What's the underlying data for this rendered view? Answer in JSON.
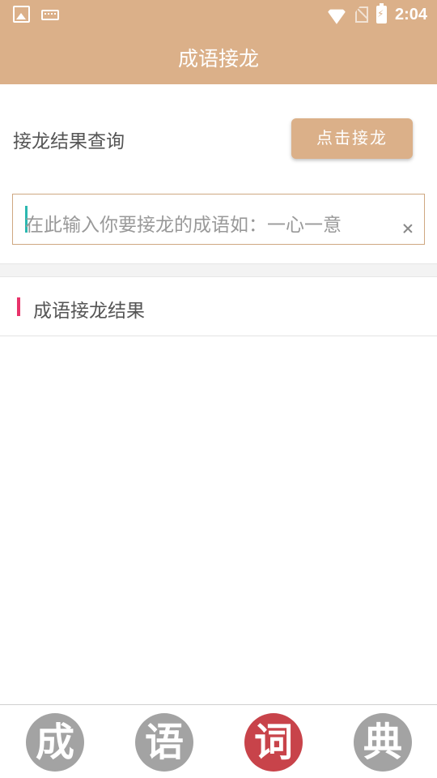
{
  "status_bar": {
    "time": "2:04",
    "left_icons": [
      "image-icon",
      "keyboard-icon"
    ],
    "right_icons": [
      "wifi-icon",
      "no-sim-icon",
      "battery-charging-icon"
    ]
  },
  "header": {
    "title": "成语接龙"
  },
  "query": {
    "label": "接龙结果查询",
    "button_label": "点击接龙"
  },
  "search": {
    "placeholder": "在此输入你要接龙的成语如：一心一意",
    "value": ""
  },
  "results": {
    "section_title": "成语接龙结果",
    "items": []
  },
  "bottom_nav": {
    "items": [
      {
        "label": "成",
        "active": false
      },
      {
        "label": "语",
        "active": false
      },
      {
        "label": "词",
        "active": true
      },
      {
        "label": "典",
        "active": false
      }
    ]
  },
  "colors": {
    "primary": "#dbb089",
    "accent_bar": "#e8336a",
    "cursor": "#2bb8b0",
    "nav_active": "#c8434a",
    "nav_inactive": "#a3a3a3"
  }
}
